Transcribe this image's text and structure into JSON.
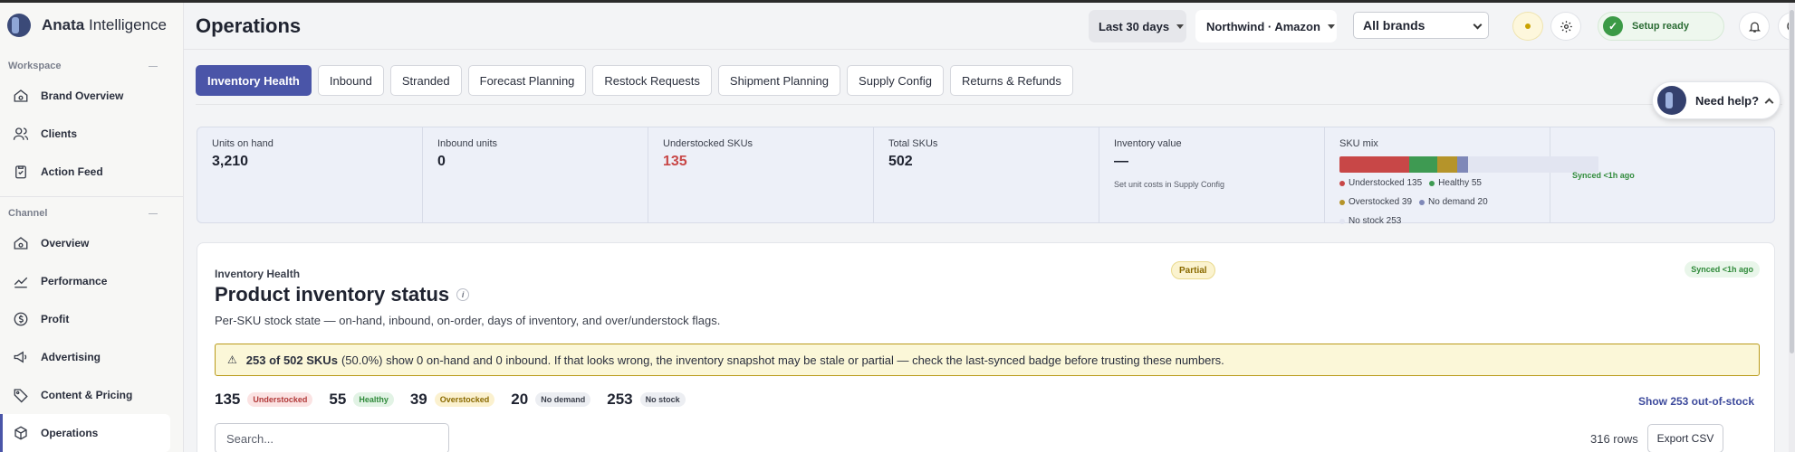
{
  "app": {
    "name_bold": "Anata",
    "name_rest": "Intelligence"
  },
  "sidebar": {
    "sections": [
      {
        "title": "Workspace",
        "items": [
          {
            "label": "Brand Overview",
            "icon": "home-icon"
          },
          {
            "label": "Clients",
            "icon": "users-icon"
          },
          {
            "label": "Action Feed",
            "icon": "clipboard-icon"
          }
        ]
      },
      {
        "title": "Channel",
        "items": [
          {
            "label": "Overview",
            "icon": "home-icon"
          },
          {
            "label": "Performance",
            "icon": "trend-icon"
          },
          {
            "label": "Profit",
            "icon": "dollar-icon"
          },
          {
            "label": "Advertising",
            "icon": "megaphone-icon"
          },
          {
            "label": "Content & Pricing",
            "icon": "tag-icon"
          },
          {
            "label": "Operations",
            "icon": "box-icon",
            "active": true
          }
        ]
      }
    ]
  },
  "header": {
    "title": "Operations",
    "date_range": "Last 30 days",
    "account": "Northwind · Amazon",
    "brand_filter": "All brands",
    "setup_status": "Setup ready"
  },
  "tabs": [
    "Inventory Health",
    "Inbound",
    "Stranded",
    "Forecast Planning",
    "Restock Requests",
    "Shipment Planning",
    "Supply Config",
    "Returns & Refunds"
  ],
  "need_help": "Need help?",
  "stats": {
    "units_on_hand": {
      "label": "Units on hand",
      "value": "3,210"
    },
    "inbound_units": {
      "label": "Inbound units",
      "value": "0"
    },
    "understocked": {
      "label": "Understocked SKUs",
      "value": "135"
    },
    "total_skus": {
      "label": "Total SKUs",
      "value": "502"
    },
    "inventory_value": {
      "label": "Inventory value",
      "value": "—",
      "sub": "Set unit costs in Supply Config"
    },
    "sku_mix": {
      "label": "SKU mix",
      "segments": [
        {
          "name": "Understocked",
          "count": 135,
          "text": "Understocked 135",
          "color": "#c84747"
        },
        {
          "name": "Healthy",
          "count": 55,
          "text": "Healthy 55",
          "color": "#3e9a52"
        },
        {
          "name": "Overstocked",
          "count": 39,
          "text": "Overstocked 39",
          "color": "#b5942a"
        },
        {
          "name": "No demand",
          "count": 20,
          "text": "No demand 20",
          "color": "#7f88b8"
        },
        {
          "name": "No stock",
          "count": 253,
          "text": "No stock 253",
          "color": "#e2e5f1"
        }
      ]
    },
    "synced": "Synced <1h ago"
  },
  "card": {
    "eyebrow": "Inventory Health",
    "title": "Product inventory status",
    "info": "i",
    "description": "Per-SKU stock state — on-hand, inbound, on-order, days of inventory, and over/understock flags.",
    "partial_badge": "Partial",
    "synced_badge": "Synced <1h ago",
    "alert": {
      "bold": "253 of 502 SKUs",
      "text": "(50.0%) show 0 on-hand and 0 inbound. If that looks wrong, the inventory snapshot may be stale or partial — check the last-synced badge before trusting these numbers."
    },
    "counts": [
      {
        "value": "135",
        "label": "Understocked",
        "bg": "#fbe3e3",
        "fg": "#b23a3a"
      },
      {
        "value": "55",
        "label": "Healthy",
        "bg": "#e2f3e5",
        "fg": "#2f8a3a"
      },
      {
        "value": "39",
        "label": "Overstocked",
        "bg": "#fbf1cf",
        "fg": "#8a6a00"
      },
      {
        "value": "20",
        "label": "No demand",
        "bg": "#eceef2",
        "fg": "#3a3f4b"
      },
      {
        "value": "253",
        "label": "No stock",
        "bg": "#eceef2",
        "fg": "#3a3f4b"
      }
    ],
    "show_oos": "Show 253 out-of-stock",
    "search_placeholder": "Search...",
    "rows": "316 rows",
    "export": "Export CSV"
  }
}
